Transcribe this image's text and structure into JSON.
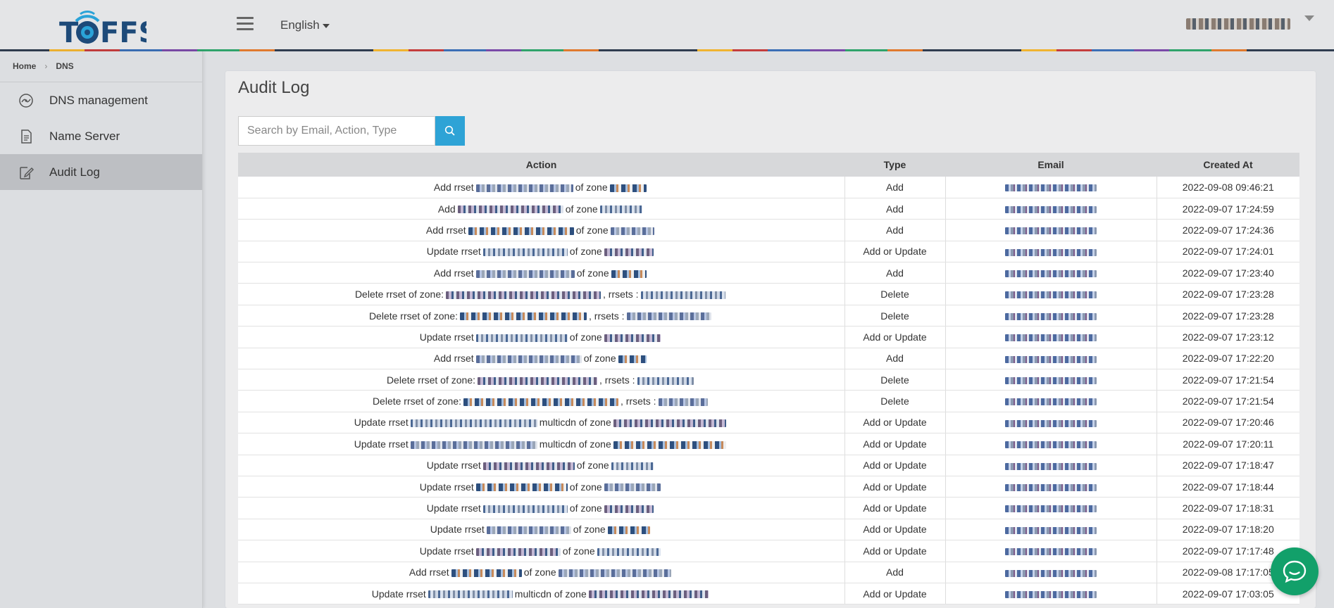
{
  "brand": {
    "logo_text": "TOFFS"
  },
  "header": {
    "language": "English"
  },
  "breadcrumb": {
    "home": "Home",
    "current": "DNS"
  },
  "sidebar": {
    "items": [
      {
        "label": "DNS management",
        "icon": "dns-management-icon",
        "active": false
      },
      {
        "label": "Name Server",
        "icon": "name-server-icon",
        "active": false
      },
      {
        "label": "Audit Log",
        "icon": "audit-log-icon",
        "active": true
      }
    ]
  },
  "main": {
    "title": "Audit Log",
    "search": {
      "placeholder": "Search by Email, Action, Type",
      "value": ""
    },
    "table": {
      "columns": [
        "Action",
        "Type",
        "Email",
        "Created At"
      ],
      "rows": [
        {
          "a1": "Add rrset",
          "a2": "of zone",
          "a3": "",
          "type": "Add",
          "date": "2022-09-08 09:46:21"
        },
        {
          "a1": "Add",
          "a2": "of zone",
          "a3": "",
          "type": "Add",
          "date": "2022-09-07 17:24:59"
        },
        {
          "a1": "Add rrset",
          "a2": "of zone",
          "a3": "",
          "type": "Add",
          "date": "2022-09-07 17:24:36"
        },
        {
          "a1": "Update rrset",
          "a2": "of zone",
          "a3": "",
          "type": "Add or Update",
          "date": "2022-09-07 17:24:01"
        },
        {
          "a1": "Add rrset",
          "a2": "of zone",
          "a3": "",
          "type": "Add",
          "date": "2022-09-07 17:23:40"
        },
        {
          "a1": "Delete rrset of zone:",
          "a2": ", rrsets :",
          "a3": "",
          "type": "Delete",
          "date": "2022-09-07 17:23:28"
        },
        {
          "a1": "Delete rrset of zone:",
          "a2": ", rrsets :",
          "a3": "",
          "type": "Delete",
          "date": "2022-09-07 17:23:28"
        },
        {
          "a1": "Update rrset",
          "a2": "of zone",
          "a3": "",
          "type": "Add or Update",
          "date": "2022-09-07 17:23:12"
        },
        {
          "a1": "Add rrset",
          "a2": "of zone",
          "a3": "",
          "type": "Add",
          "date": "2022-09-07 17:22:20"
        },
        {
          "a1": "Delete rrset of zone:",
          "a2": ", rrsets :",
          "a3": "",
          "type": "Delete",
          "date": "2022-09-07 17:21:54"
        },
        {
          "a1": "Delete rrset of zone:",
          "a2": ", rrsets :",
          "a3": "",
          "type": "Delete",
          "date": "2022-09-07 17:21:54"
        },
        {
          "a1": "Update rrset",
          "a2": "multicdn of zone",
          "a3": "",
          "type": "Add or Update",
          "date": "2022-09-07 17:20:46"
        },
        {
          "a1": "Update rrset",
          "a2": "multicdn of zone",
          "a3": "",
          "type": "Add or Update",
          "date": "2022-09-07 17:20:11"
        },
        {
          "a1": "Update rrset",
          "a2": "of zone",
          "a3": "",
          "type": "Add or Update",
          "date": "2022-09-07 17:18:47"
        },
        {
          "a1": "Update rrset",
          "a2": "of zone",
          "a3": "",
          "type": "Add or Update",
          "date": "2022-09-07 17:18:44"
        },
        {
          "a1": "Update rrset",
          "a2": "of zone",
          "a3": "",
          "type": "Add or Update",
          "date": "2022-09-07 17:18:31"
        },
        {
          "a1": "Update rrset",
          "a2": "of zone",
          "a3": "",
          "type": "Add or Update",
          "date": "2022-09-07 17:18:20"
        },
        {
          "a1": "Update rrset",
          "a2": "of zone",
          "a3": "",
          "type": "Add or Update",
          "date": "2022-09-07 17:17:48"
        },
        {
          "a1": "Add rrset",
          "a2": "of zone",
          "a3": "",
          "type": "Add",
          "date": "2022-09-08 17:17:05"
        },
        {
          "a1": "Update rrset",
          "a2": "multicdn of zone",
          "a3": "",
          "type": "Add or Update",
          "date": "2022-09-07 17:03:05"
        }
      ]
    }
  },
  "colors": {
    "accent": "#2ea3d6",
    "chat": "#12a06a",
    "logo": "#1d4a79"
  },
  "chat": {
    "icon": "chat-bubble-icon"
  }
}
